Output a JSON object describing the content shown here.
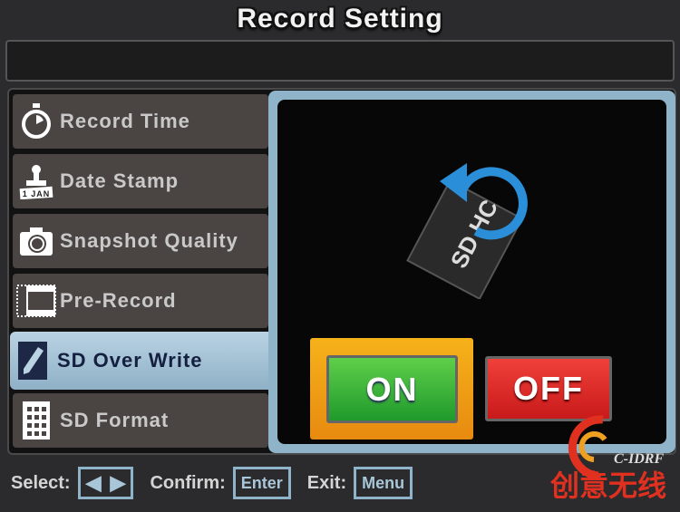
{
  "title": "Record Setting",
  "menu": {
    "items": [
      {
        "label": "Record Time",
        "icon": "stopwatch-icon"
      },
      {
        "label": "Date Stamp",
        "icon": "stamp-icon",
        "icon_text": "1 JAN"
      },
      {
        "label": "Snapshot Quality",
        "icon": "camera-icon"
      },
      {
        "label": "Pre-Record",
        "icon": "film-icon"
      },
      {
        "label": "SD Over Write",
        "icon": "pencil-icon",
        "selected": true
      },
      {
        "label": "SD Format",
        "icon": "grid-icon"
      }
    ]
  },
  "content": {
    "icon": "sd-card-overwrite-icon",
    "card_text": "SD HC",
    "on_label": "ON",
    "off_label": "OFF",
    "selected": "ON"
  },
  "footer": {
    "select_label": "Select:",
    "confirm_label": "Confirm:",
    "confirm_key": "Enter",
    "exit_label": "Exit:",
    "exit_key": "Menu"
  },
  "watermark": {
    "latin": "C-IDRF",
    "chinese": "创意无线"
  },
  "colors": {
    "accent": "#8fb3c8",
    "on": "#2fae35",
    "off": "#d82a26",
    "frame": "#f2a516"
  }
}
